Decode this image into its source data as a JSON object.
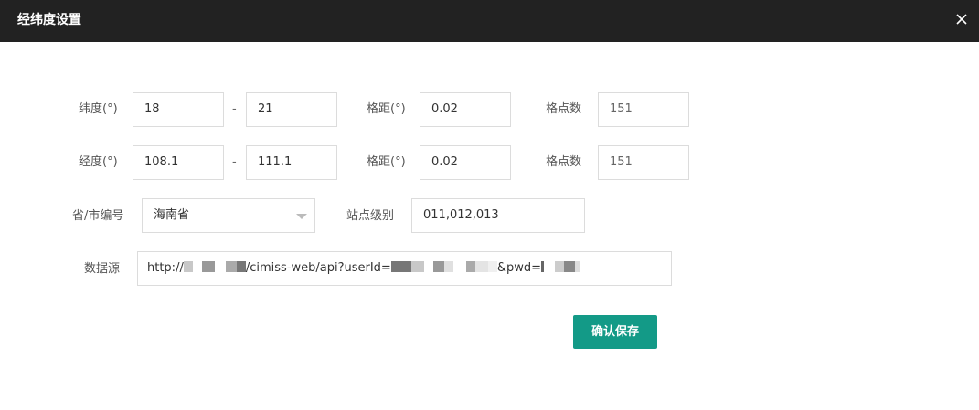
{
  "dialog": {
    "title": "经纬度设置",
    "close_icon": "close-icon"
  },
  "latitude": {
    "label": "纬度(°)",
    "from": "18",
    "separator": "-",
    "to": "21",
    "step_label": "格距(°)",
    "step": "0.02",
    "count_label": "格点数",
    "count": "151"
  },
  "longitude": {
    "label": "经度(°)",
    "from": "108.1",
    "separator": "-",
    "to": "111.1",
    "step_label": "格距(°)",
    "step": "0.02",
    "count_label": "格点数",
    "count": "151"
  },
  "province": {
    "label": "省/市编号",
    "selected": "海南省"
  },
  "station": {
    "label": "站点级别",
    "value": "011,012,013"
  },
  "datasource": {
    "label": "数据源",
    "url_prefix": "http://",
    "url_middle": "/cimiss-web/api?userId=",
    "url_pwd": "&pwd="
  },
  "save_button": "确认保存"
}
